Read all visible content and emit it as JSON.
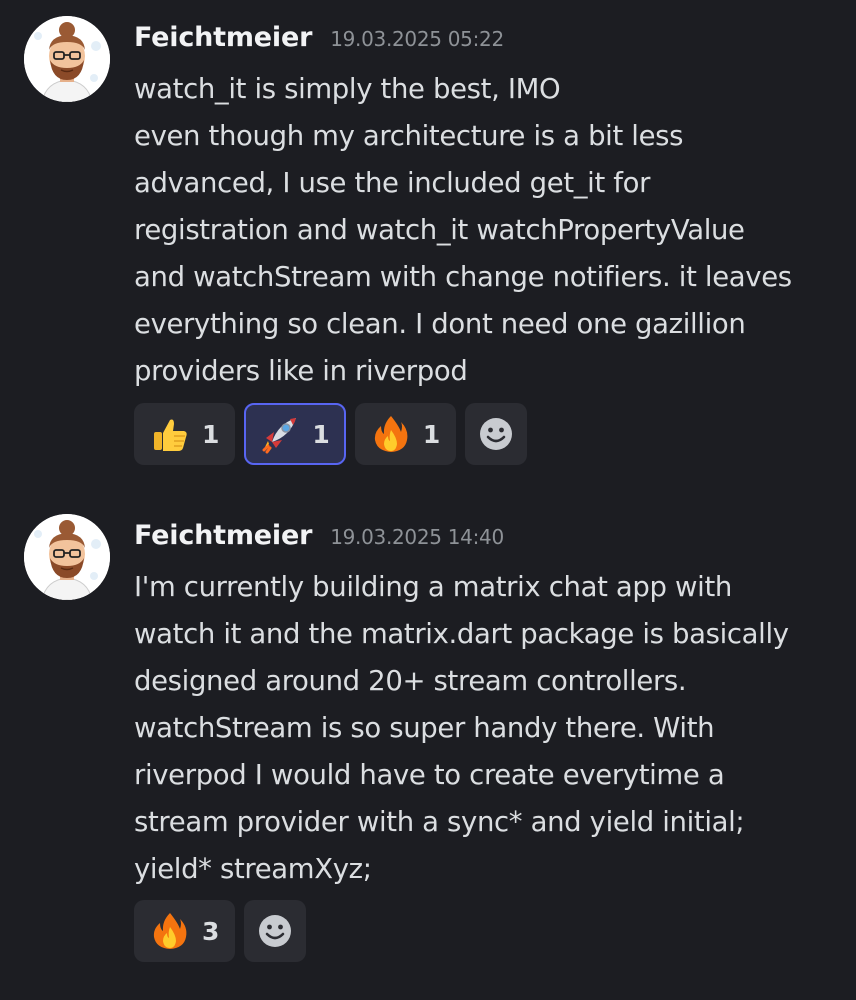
{
  "messages": [
    {
      "username": "Feichtmeier",
      "timestamp": "19.03.2025 05:22",
      "lines": [
        "watch_it is simply the best, IMO",
        "even though my architecture is a bit less",
        "advanced, I use the included get_it for",
        "registration and watch_it watchPropertyValue",
        "and watchStream with change notifiers. it leaves",
        "everything so clean. I dont need one gazillion",
        "providers like in riverpod"
      ],
      "reactions": [
        {
          "emoji": "thumbs-up-icon",
          "count": "1",
          "active": false
        },
        {
          "emoji": "rocket-icon",
          "count": "1",
          "active": true
        },
        {
          "emoji": "fire-icon",
          "count": "1",
          "active": false
        }
      ]
    },
    {
      "username": "Feichtmeier",
      "timestamp": "19.03.2025 14:40",
      "lines": [
        "I'm currently building a matrix chat app with",
        "watch it and the matrix.dart package is basically",
        "designed around 20+ stream controllers.",
        "watchStream is so super handy there. With",
        "riverpod I would have to create everytime a",
        "stream provider with a sync* and yield initial;",
        "yield* streamXyz;"
      ],
      "reactions": [
        {
          "emoji": "fire-icon",
          "count": "3",
          "active": false
        }
      ]
    }
  ],
  "colors": {
    "background": "#1c1d22",
    "username": "#f2f3f5",
    "timestamp": "#8e9297",
    "text": "#dbdee1",
    "reaction_bg": "#2b2c32",
    "reaction_active_border": "#5865f2"
  }
}
